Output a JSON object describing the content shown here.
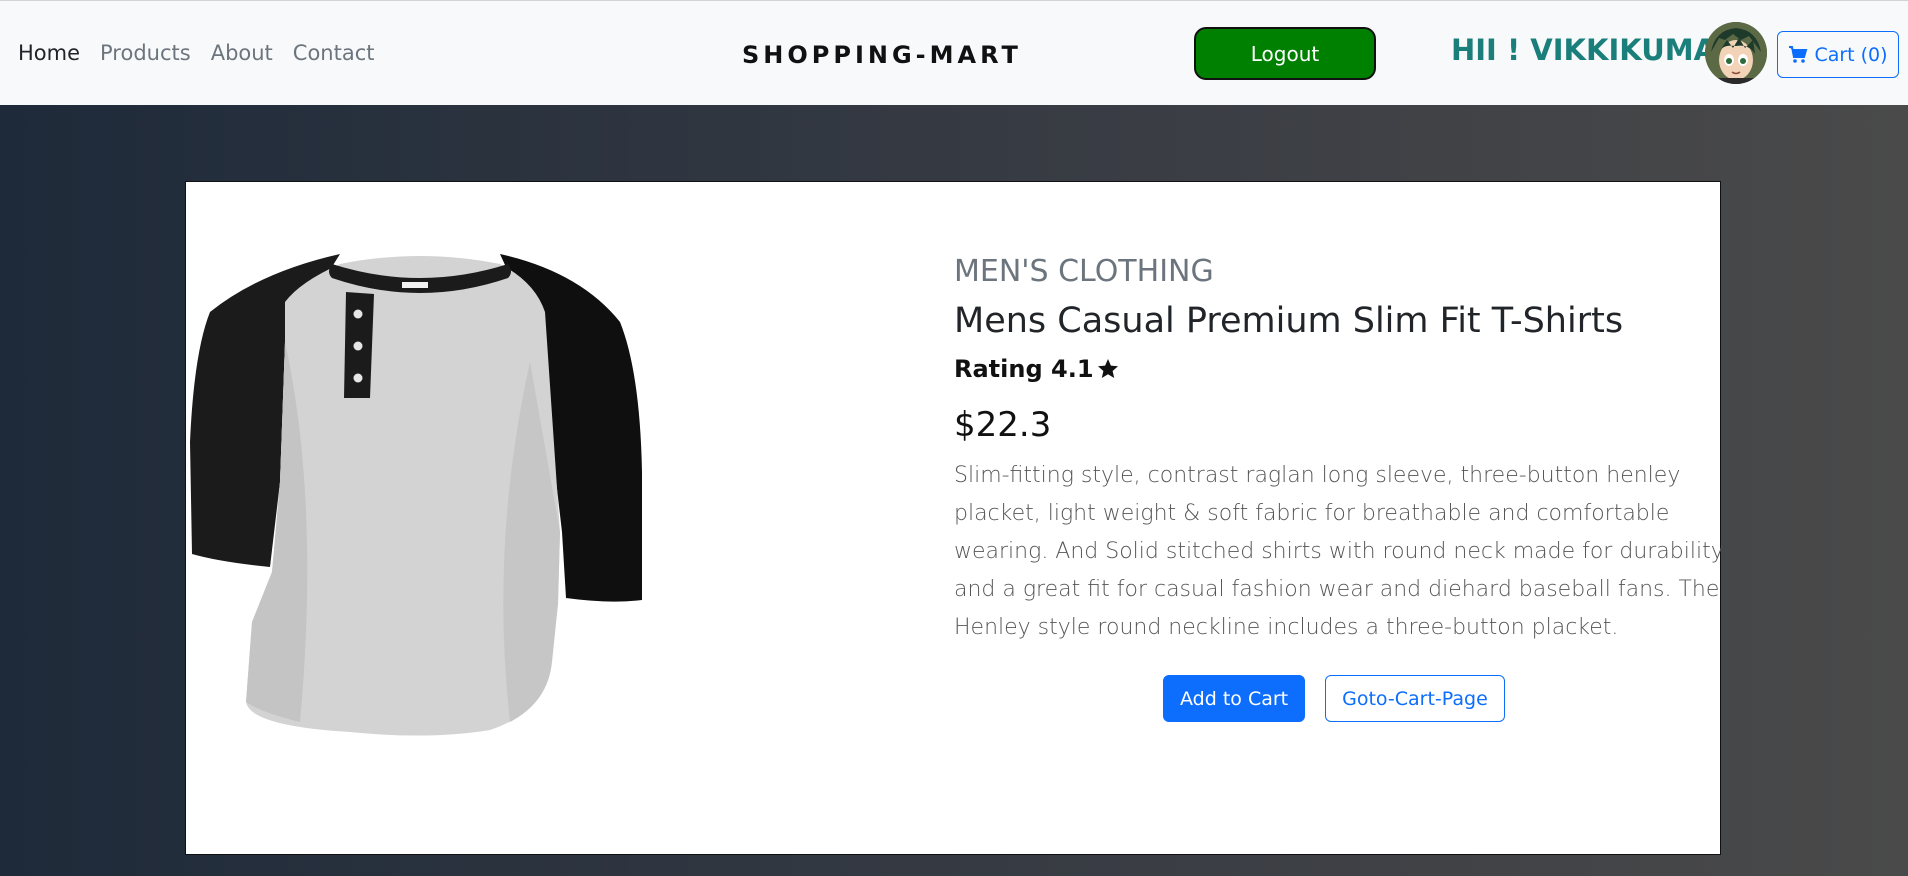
{
  "nav": {
    "links": [
      {
        "label": "Home"
      },
      {
        "label": "Products"
      },
      {
        "label": "About"
      },
      {
        "label": "Contact"
      }
    ],
    "brand": "SHOPPING-MART",
    "logout_label": "Logout",
    "greeting": "HII ! VIKKIKUMAR",
    "cart_label": "Cart (0)"
  },
  "product": {
    "category": "MEN'S CLOTHING",
    "title": "Mens Casual Premium Slim Fit T-Shirts",
    "rating_label": "Rating 4.1",
    "price": "$22.3",
    "description": "Slim-fitting style, contrast raglan long sleeve, three-button henley placket, light weight & soft fabric for breathable and comfortable wearing. And Solid stitched shirts with round neck made for durability and a great fit for casual fashion wear and diehard baseball fans. The Henley style round neckline includes a three-button placket.",
    "add_to_cart_label": "Add to Cart",
    "goto_cart_label": "Goto-Cart-Page"
  },
  "colors": {
    "logout_bg": "#008000",
    "greeting": "#1a7f7a",
    "primary": "#0d6efd"
  },
  "icons": [
    "cart-icon",
    "star-icon",
    "avatar"
  ]
}
